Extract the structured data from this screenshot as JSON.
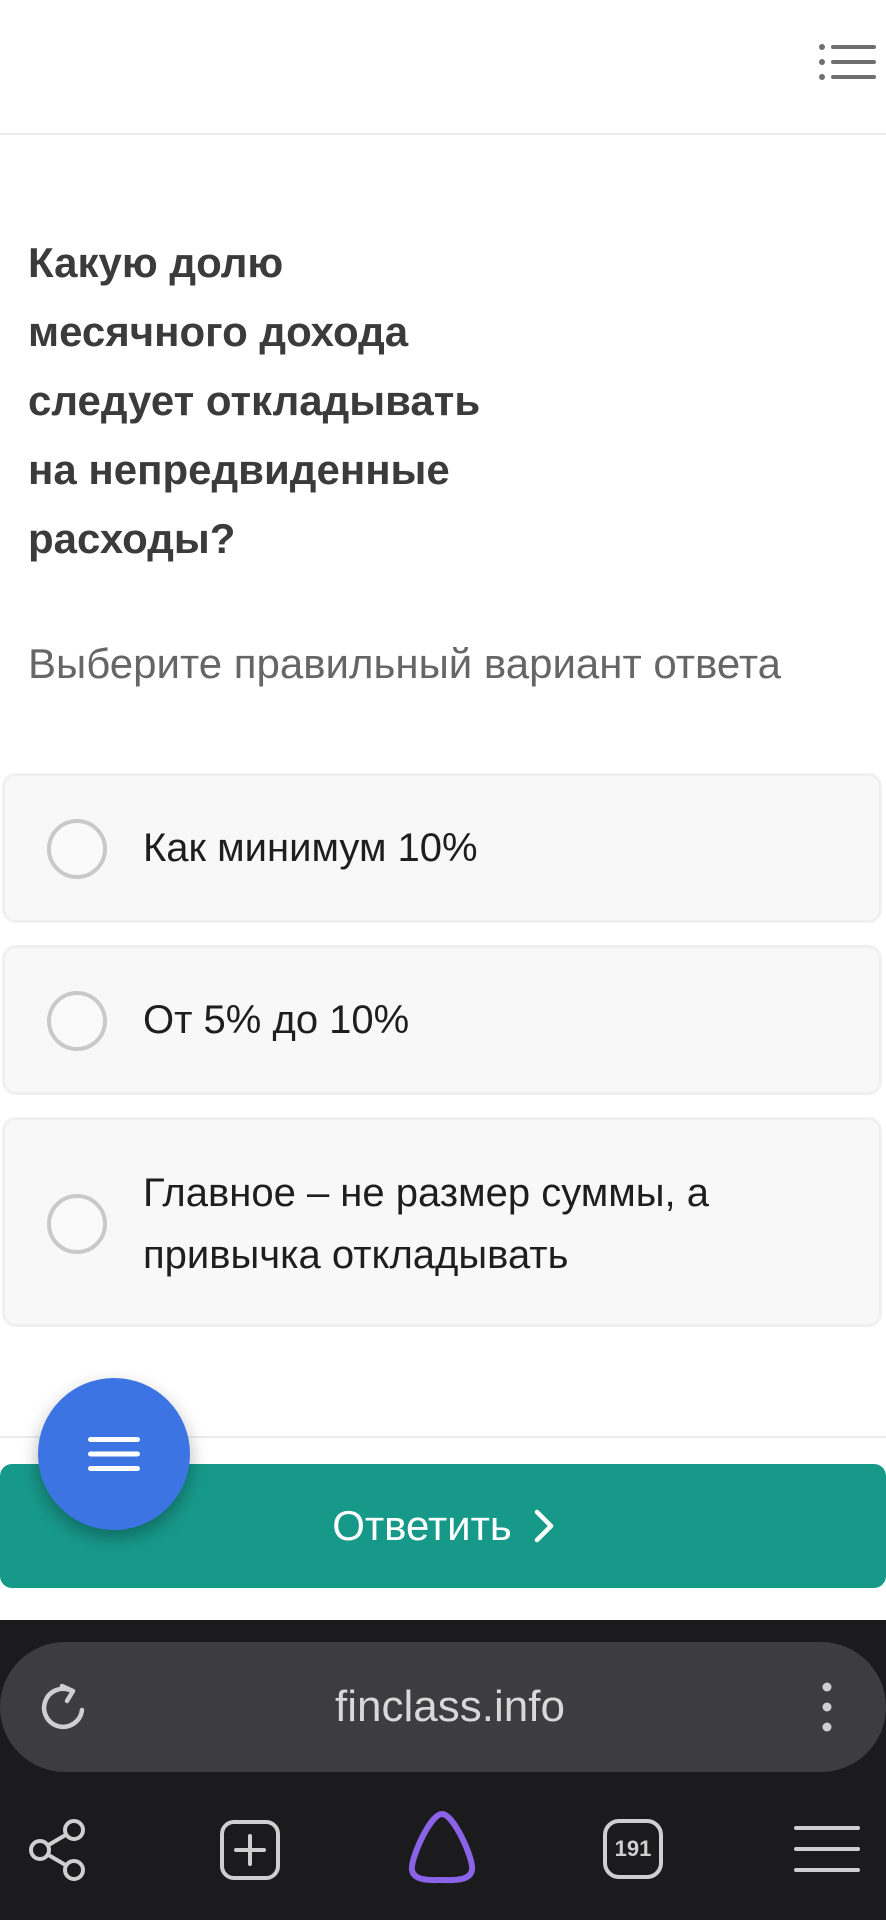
{
  "question": {
    "lines": [
      "Какую долю",
      "месячного дохода",
      "следует откладывать",
      "на непредвиденные",
      "расходы?"
    ]
  },
  "hint": "Выберите правильный вариант ответа",
  "options": [
    {
      "line1": "Как минимум 10%",
      "line2": ""
    },
    {
      "line1": "От 5% до 10%",
      "line2": ""
    },
    {
      "line1": "Главное – не размер суммы, а",
      "line2": "привычка откладывать"
    }
  ],
  "answer_button": {
    "label": "Ответить"
  },
  "browser": {
    "url": "finclass.info",
    "tabs_count": "191"
  },
  "colors": {
    "accent": "#17998a",
    "fab": "#3c74e3",
    "browser_bg": "#1b1b1d"
  },
  "icons": {
    "header_menu": "list-icon",
    "fab": "hamburger-icon",
    "reload": "reload-icon",
    "more": "more-vertical-icon",
    "share": "share-icon",
    "new_tab": "new-tab-icon",
    "assistant": "alice-icon",
    "tabs": "tabs-icon",
    "browser_menu": "hamburger-icon"
  }
}
